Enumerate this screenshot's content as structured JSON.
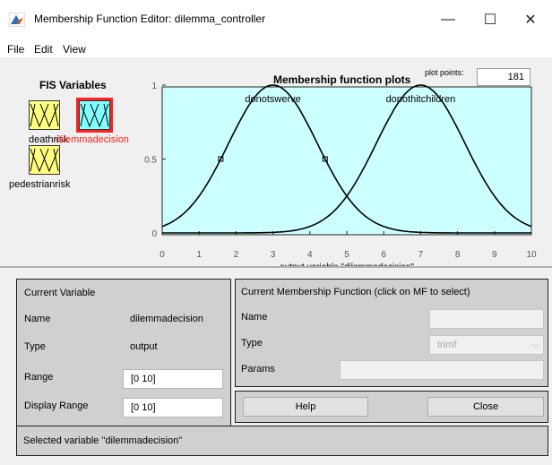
{
  "window": {
    "title": "Membership Function Editor: dilemma_controller",
    "minimize": "—",
    "maximize": "☐",
    "close": "✕"
  },
  "menu": [
    "File",
    "Edit",
    "View"
  ],
  "fis_variables": {
    "title": "FIS Variables",
    "inputs": [
      "deathrisk",
      "pedestrianrisk"
    ],
    "output": "dilemmadecision",
    "selected": "dilemmadecision"
  },
  "plot": {
    "title": "Membership function plots",
    "plot_points_label": "plot points:",
    "plot_points_value": "181",
    "xlabel": "output variable \"dilemmadecision\"",
    "xticks": [
      "0",
      "1",
      "2",
      "3",
      "4",
      "5",
      "6",
      "7",
      "8",
      "9",
      "10"
    ],
    "yticks": [
      "0",
      "0.5",
      "1"
    ],
    "mf_names": [
      "donotswerve",
      "donothitchildren"
    ],
    "background_color": "#ccffff"
  },
  "chart_data": {
    "type": "line",
    "title": "Membership function plots",
    "xlabel": "output variable \"dilemmadecision\"",
    "ylabel": "",
    "xlim": [
      0,
      10
    ],
    "ylim": [
      0,
      1
    ],
    "series": [
      {
        "name": "donotswerve",
        "shape": "gaussmf",
        "sigma": 1.2,
        "center": 3
      },
      {
        "name": "donothitchildren",
        "shape": "gaussmf",
        "sigma": 1.2,
        "center": 7
      }
    ]
  },
  "current_variable": {
    "title": "Current Variable",
    "name_label": "Name",
    "name_value": "dilemmadecision",
    "type_label": "Type",
    "type_value": "output",
    "range_label": "Range",
    "range_value": "[0 10]",
    "display_range_label": "Display Range",
    "display_range_value": "[0 10]"
  },
  "current_mf": {
    "title": "Current Membership Function (click on MF to select)",
    "name_label": "Name",
    "name_value": "",
    "type_label": "Type",
    "type_value": "trimf",
    "params_label": "Params",
    "params_value": ""
  },
  "buttons": {
    "help": "Help",
    "close": "Close"
  },
  "status": "Selected variable \"dilemmadecision\""
}
